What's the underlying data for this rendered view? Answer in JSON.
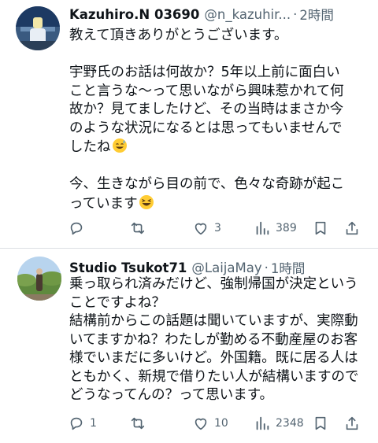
{
  "tweets": [
    {
      "name": "Kazuhiro.N 03690",
      "handle": "@n_kazuhir...",
      "time": "2時間",
      "lines": [
        "教えて頂きありがとうございます。",
        "",
        "宇野氏のお話は何故か？5年以上前に面白い",
        "こと言うな〜って思いながら興味惹かれて何",
        "故か？見てましたけど、その当時はまさか今",
        "のような状況になるとは思ってもいませんで",
        "したね",
        "",
        "今、生きながら目の前で、色々な奇跡が起こ",
        "っています"
      ],
      "reply_count": "",
      "retweet_count": "",
      "like_count": "3",
      "view_count": "389"
    },
    {
      "name": "Studio Tsukot71",
      "handle": "@LaijaMay",
      "time": "1時間",
      "lines": [
        "乗っ取られ済みだけど、強制帰国が決定という",
        "ことですよね？",
        "結構前からこの話題は聞いていますが、実際動",
        "いてますかね？わたしが勤める不動産屋のお客",
        "様でいまだに多いけど。外国籍。既に居る人は",
        "ともかく、新規で借りたい人が結構いますので",
        "どうなってんの？って思います。"
      ],
      "reply_count": "1",
      "retweet_count": "",
      "like_count": "10",
      "view_count": "2348"
    }
  ],
  "separator": "·",
  "icons": [
    "reply-icon",
    "retweet-icon",
    "like-icon",
    "views-icon",
    "bookmark-icon",
    "share-icon",
    "sweat-smile-emoji",
    "laughing-emoji"
  ],
  "colors": {
    "text": "#0f1419",
    "secondary": "#536471",
    "divider": "#dcdfe3"
  }
}
